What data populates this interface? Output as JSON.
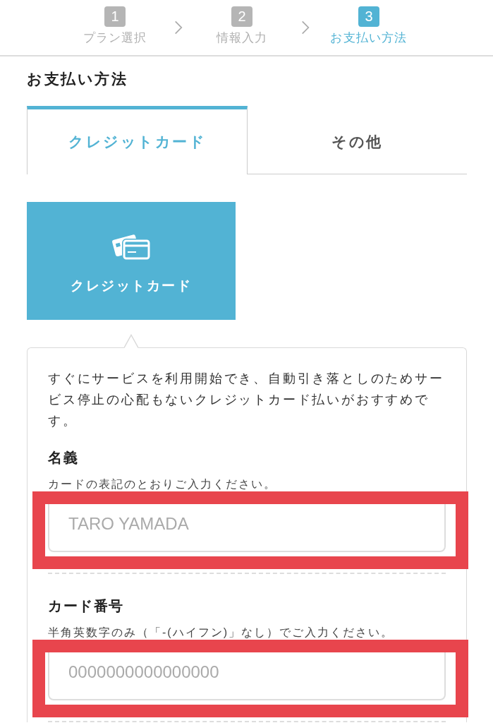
{
  "steps": [
    {
      "number": "1",
      "label": "プラン選択",
      "selected": false
    },
    {
      "number": "2",
      "label": "情報入力",
      "selected": false
    },
    {
      "number": "3",
      "label": "お支払い方法",
      "selected": true
    }
  ],
  "section_title": "お支払い方法",
  "tabs": [
    {
      "label": "クレジットカード",
      "selected": true
    },
    {
      "label": "その他",
      "selected": false
    }
  ],
  "payment_options": [
    {
      "label": "クレジットカード",
      "selected": true
    }
  ],
  "panel": {
    "description": "すぐにサービスを利用開始でき、自動引き落としのためサービス停止の心配もないクレジットカード払いがおすすめです。",
    "fields": [
      {
        "label": "名義",
        "hint": "カードの表記のとおりご入力ください。",
        "placeholder": "TARO YAMADA",
        "highlighted": true
      },
      {
        "label": "カード番号",
        "hint": "半角英数字のみ（「-(ハイフン)」なし）でご入力ください。",
        "placeholder": "0000000000000000",
        "highlighted": true
      }
    ]
  }
}
